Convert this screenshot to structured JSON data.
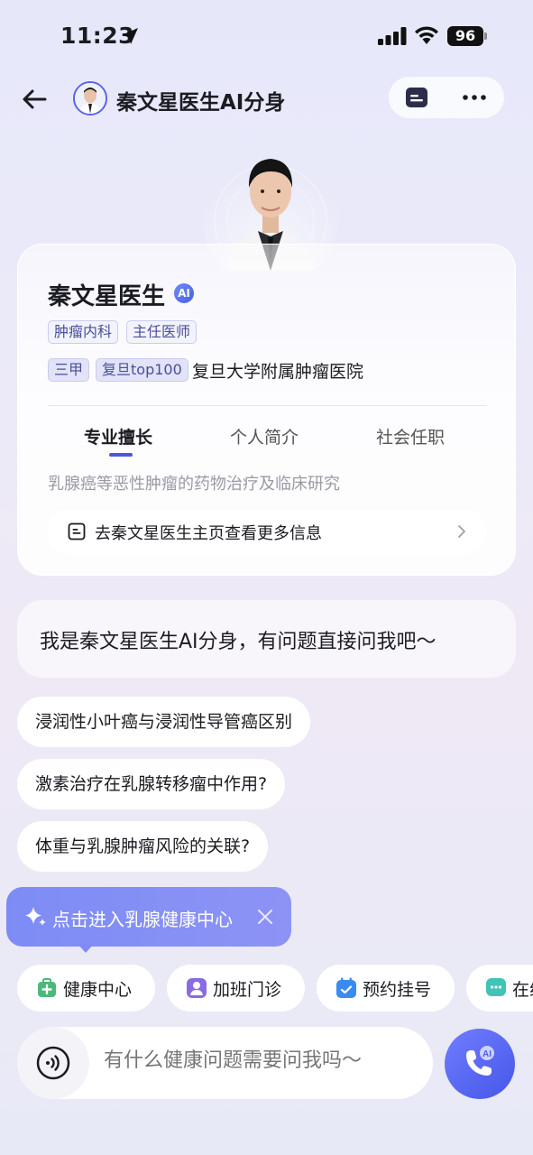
{
  "status_bar": {
    "time": "11:23",
    "battery": "96"
  },
  "nav": {
    "title": "秦文星医生AI分身"
  },
  "profile": {
    "name": "秦文星医生",
    "ai_badge": "AI",
    "tags_row1": [
      "肿瘤内科",
      "主任医师"
    ],
    "tags_row2": [
      "三甲",
      "复旦top100"
    ],
    "hospital": "复旦大学附属肿瘤医院",
    "tabs": [
      {
        "label": "专业擅长",
        "active": true
      },
      {
        "label": "个人简介",
        "active": false
      },
      {
        "label": "社会任职",
        "active": false
      }
    ],
    "specialty": "乳腺癌等恶性肿瘤的药物治疗及临床研究",
    "more_info": "去秦文星医生主页查看更多信息"
  },
  "greeting": "我是秦文星医生AI分身，有问题直接问我吧～",
  "suggestions": [
    "浸润性小叶癌与浸润性导管癌区别",
    "激素治疗在乳腺转移瘤中作用?",
    "体重与乳腺肿瘤风险的关联?"
  ],
  "tooltip": {
    "text": "点击进入乳腺健康中心"
  },
  "quick_actions": [
    {
      "label": "健康中心",
      "icon": "health-center-icon",
      "color": "#4cb87a"
    },
    {
      "label": "加班门诊",
      "icon": "extra-clinic-icon",
      "color": "#8a6be0"
    },
    {
      "label": "预约挂号",
      "icon": "calendar-icon",
      "color": "#3b8af0"
    },
    {
      "label": "在线",
      "icon": "chat-icon",
      "color": "#3fc4b6"
    }
  ],
  "input": {
    "placeholder": "有什么健康问题需要问我吗～"
  },
  "call_button": {
    "badge": "AI"
  },
  "colors": {
    "accent": "#4a57e0",
    "tooltip": "#8089f5",
    "tag_border": "#c9ccef"
  }
}
